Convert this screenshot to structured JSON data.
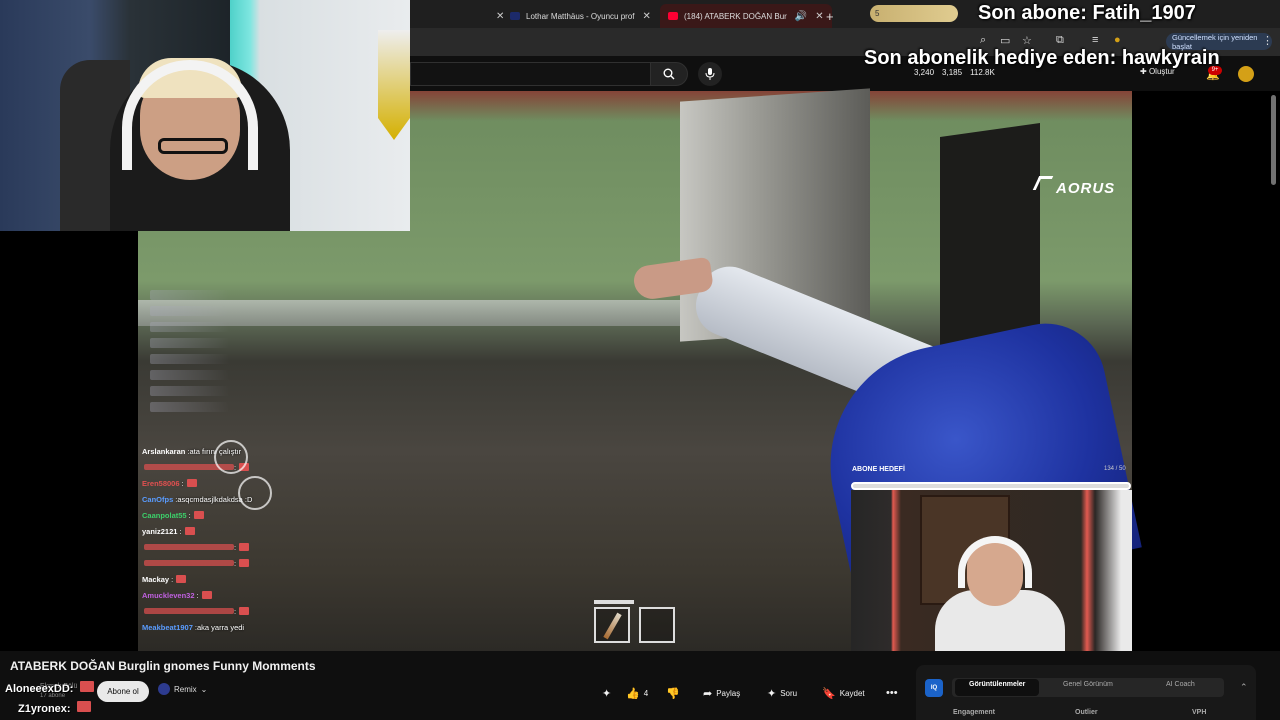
{
  "browser": {
    "tabs": [
      {
        "label": "Lothar Matthäus - Oyuncu prof",
        "active": false
      },
      {
        "label": "(184) ATABERK DOĞAN Bur",
        "active": true
      }
    ],
    "new_tab": "+",
    "update_label": "Güncellemek için yeniden başlat"
  },
  "header": {
    "stats": [
      "3,240",
      "3,185",
      "112.8K"
    ],
    "create_label": "Oluştur",
    "notification_badge": "9+"
  },
  "overlay": {
    "last_sub": "Son abone: Fatih_1907",
    "last_gift": "Son abonelik hediye eden: hawkyrain",
    "goal_bar_text": "5",
    "goal_label": "ABONE HEDEFİ",
    "goal_count": "134 / 50",
    "brand": "AORUS"
  },
  "chat": [
    {
      "name": "Arslankaran",
      "msg": "ata fırını çalıştır",
      "color": "#ffffff"
    },
    {
      "name": "",
      "msg": "",
      "color": "#e05050",
      "emote": true
    },
    {
      "name": "Eren58006",
      "msg": "",
      "color": "#e05050",
      "emote": true
    },
    {
      "name": "CanOfps",
      "msg": "asqcmdasjlkdakdsa :D",
      "color": "#5a9cff"
    },
    {
      "name": "Caanpolat55",
      "msg": "",
      "color": "#3ccf6a",
      "emote": true
    },
    {
      "name": "yaniz2121",
      "msg": "",
      "color": "#ffffff",
      "emote": true
    },
    {
      "name": "",
      "msg": "",
      "color": "#e05050",
      "emote": true
    },
    {
      "name": "",
      "msg": "",
      "color": "#e05050",
      "emote": true
    },
    {
      "name": "Mackay",
      "msg": "",
      "color": "#ffffff",
      "emote": true
    },
    {
      "name": "Amuckleven32",
      "msg": "",
      "color": "#c060e0",
      "emote": true
    },
    {
      "name": "",
      "msg": "",
      "color": "#e05050",
      "emote": true
    },
    {
      "name": "Meakbeat1907",
      "msg": "aka yarra yedi",
      "color": "#5a9cff"
    }
  ],
  "video": {
    "title": "ATABERK DOĞAN Burglin gnomes Funny Momments"
  },
  "channel": {
    "subscribe_label": "Abone ol",
    "remix_label": "Remix",
    "sub_count": "17 abone",
    "name_faded": "Ekmek Bölü"
  },
  "bottom_chat": [
    {
      "name": "AloneeexDD",
      "suffix": ":"
    },
    {
      "name": "Z1yronex",
      "suffix": ":"
    }
  ],
  "actions": {
    "like_count": "4",
    "share_label": "Paylaş",
    "ask_label": "Soru",
    "save_label": "Kaydet"
  },
  "panel": {
    "badge": "IQ",
    "tabs": [
      "Görüntülenmeler",
      "Genel Görünüm",
      "AI Coach"
    ],
    "footer": [
      "Engagement",
      "Outlier",
      "VPH"
    ]
  }
}
